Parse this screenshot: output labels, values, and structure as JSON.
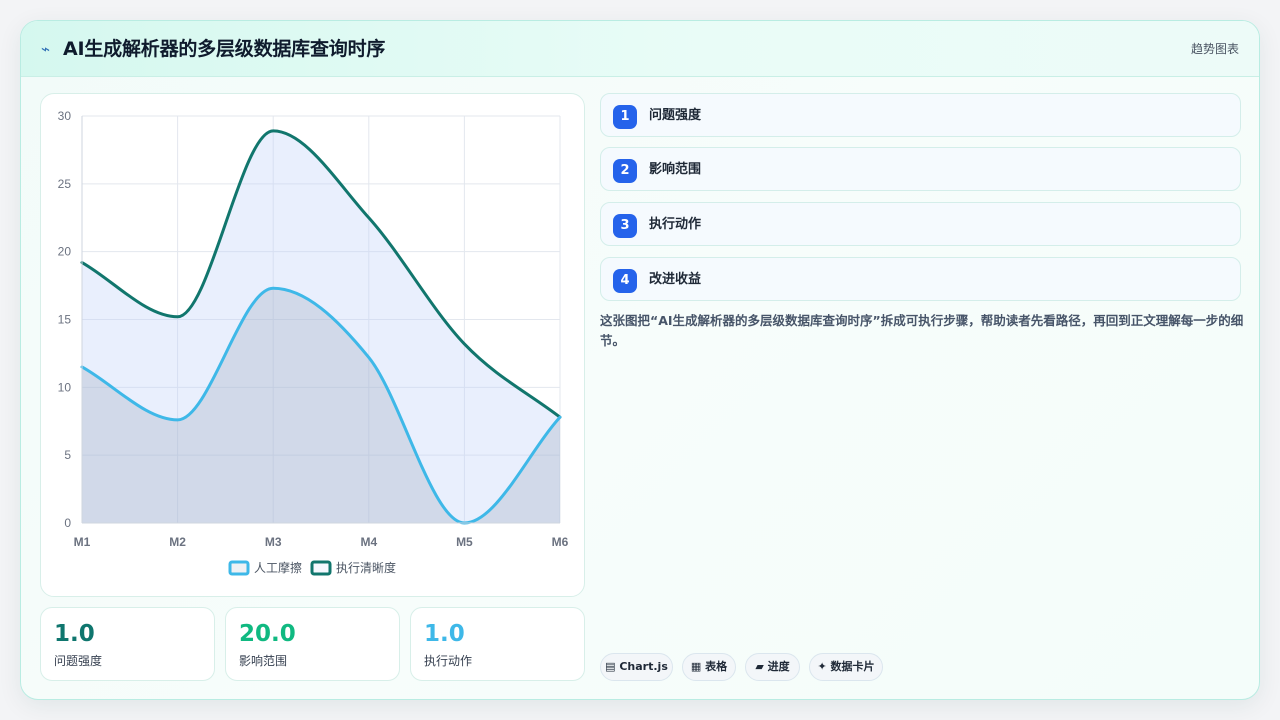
{
  "header": {
    "icon": "chart-line-icon",
    "title": "AI生成解析器的多层级数据库查询时序",
    "tag": "趋势图表"
  },
  "chart_data": {
    "type": "line",
    "categories": [
      "M1",
      "M2",
      "M3",
      "M4",
      "M5",
      "M6"
    ],
    "ylim": [
      0,
      30
    ],
    "yticks": [
      0,
      5,
      10,
      15,
      20,
      25,
      30
    ],
    "grid": true,
    "legend_position": "bottom",
    "series": [
      {
        "name": "人工摩擦",
        "values": [
          11.5,
          7.6,
          17.3,
          12.2,
          0.0,
          7.8
        ],
        "color": "#3eb8e8",
        "fill": "rgba(148,163,184,0.28)"
      },
      {
        "name": "执行清晰度",
        "values": [
          19.2,
          15.2,
          28.9,
          22.5,
          13.2,
          7.8
        ],
        "color": "#11766d",
        "fill": "rgba(191,210,250,0.35)"
      }
    ]
  },
  "stats": [
    {
      "value": "1.0",
      "label": "问题强度",
      "color": "#0f766e"
    },
    {
      "value": "20.0",
      "label": "影响范围",
      "color": "#10b981"
    },
    {
      "value": "1.0",
      "label": "执行动作",
      "color": "#3eb8e8"
    }
  ],
  "steps": [
    {
      "num": "1",
      "label": "问题强度"
    },
    {
      "num": "2",
      "label": "影响范围"
    },
    {
      "num": "3",
      "label": "执行动作"
    },
    {
      "num": "4",
      "label": "改进收益"
    }
  ],
  "description": "这张图把“AI生成解析器的多层级数据库查询时序”拆成可执行步骤，帮助读者先看路径，再回到正文理解每一步的细节。",
  "chips": [
    {
      "icon": "▤",
      "label": "Chart.js"
    },
    {
      "icon": "▦",
      "label": "表格"
    },
    {
      "icon": "▰",
      "label": "进度"
    },
    {
      "icon": "✦",
      "label": "数据卡片"
    }
  ]
}
